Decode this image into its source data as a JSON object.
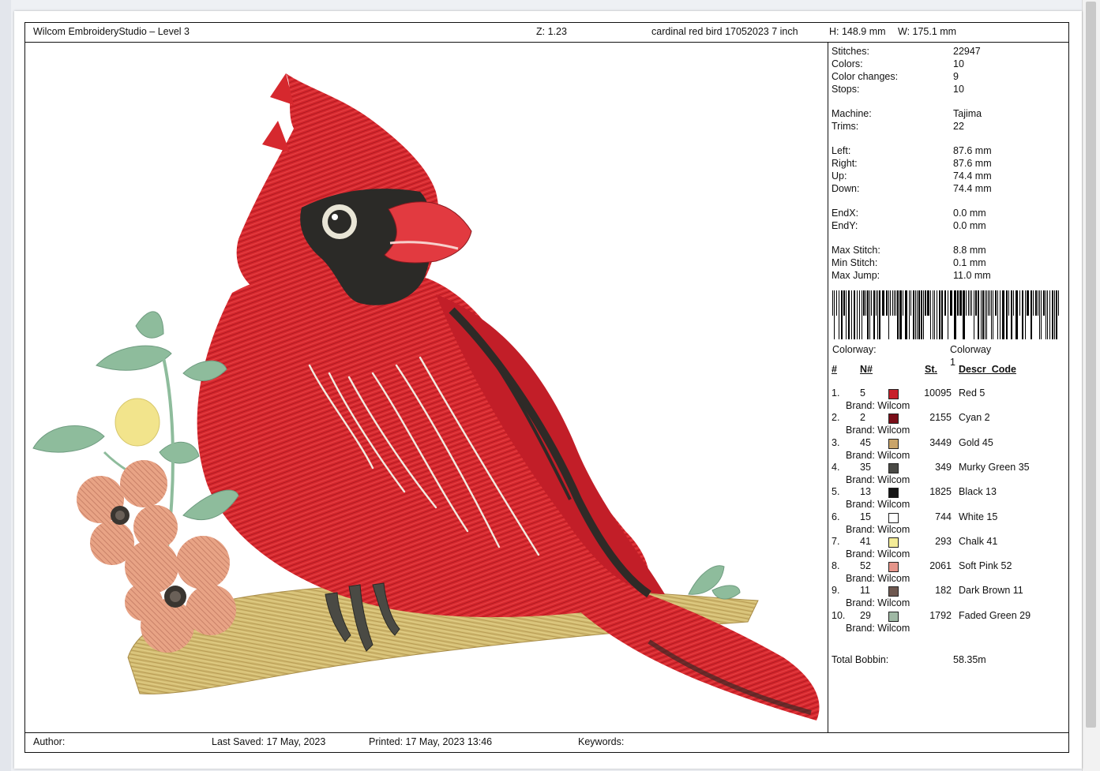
{
  "header": {
    "app": "Wilcom EmbroideryStudio – Level 3",
    "zoom": "Z: 1.23",
    "design_name": "cardinal red bird 17052023 7 inch",
    "height": "H: 148.9 mm",
    "width": "W: 175.1 mm"
  },
  "stats": [
    {
      "label": "Stitches:",
      "value": "22947"
    },
    {
      "label": "Colors:",
      "value": "10"
    },
    {
      "label": "Color changes:",
      "value": "9"
    },
    {
      "label": "Stops:",
      "value": "10"
    },
    {
      "label": "Machine:",
      "value": "Tajima"
    },
    {
      "label": "Trims:",
      "value": "22"
    },
    {
      "label": "Left:",
      "value": "87.6 mm"
    },
    {
      "label": "Right:",
      "value": "87.6 mm"
    },
    {
      "label": "Up:",
      "value": "74.4 mm"
    },
    {
      "label": "Down:",
      "value": "74.4 mm"
    },
    {
      "label": "EndX:",
      "value": "0.0 mm"
    },
    {
      "label": "EndY:",
      "value": "0.0 mm"
    },
    {
      "label": "Max Stitch:",
      "value": "8.8 mm"
    },
    {
      "label": "Min Stitch:",
      "value": "0.1 mm"
    },
    {
      "label": "Max Jump:",
      "value": "11.0 mm"
    }
  ],
  "colorway": {
    "label": "Colorway:",
    "value": "Colorway 1"
  },
  "table_headers": {
    "idx": "#",
    "num": "N#",
    "stitches": "St.",
    "descr": "Descr_Code"
  },
  "threads": [
    {
      "idx": "1.",
      "num": "5",
      "color": "#c8202a",
      "stitches": "10095",
      "descr": "Red 5",
      "brand": "Brand: Wilcom"
    },
    {
      "idx": "2.",
      "num": "2",
      "color": "#7a0e18",
      "stitches": "2155",
      "descr": "Cyan 2",
      "brand": "Brand: Wilcom"
    },
    {
      "idx": "3.",
      "num": "45",
      "color": "#c9a46a",
      "stitches": "3449",
      "descr": "Gold 45",
      "brand": "Brand: Wilcom"
    },
    {
      "idx": "4.",
      "num": "35",
      "color": "#4a4a46",
      "stitches": "349",
      "descr": "Murky Green 35",
      "brand": "Brand: Wilcom"
    },
    {
      "idx": "5.",
      "num": "13",
      "color": "#161616",
      "stitches": "1825",
      "descr": "Black 13",
      "brand": "Brand: Wilcom"
    },
    {
      "idx": "6.",
      "num": "15",
      "color": "#ffffff",
      "stitches": "744",
      "descr": "White 15",
      "brand": "Brand: Wilcom"
    },
    {
      "idx": "7.",
      "num": "41",
      "color": "#f4ec98",
      "stitches": "293",
      "descr": "Chalk 41",
      "brand": "Brand: Wilcom"
    },
    {
      "idx": "8.",
      "num": "52",
      "color": "#e5958a",
      "stitches": "2061",
      "descr": "Soft Pink 52",
      "brand": "Brand: Wilcom"
    },
    {
      "idx": "9.",
      "num": "11",
      "color": "#6e5850",
      "stitches": "182",
      "descr": "Dark Brown 11",
      "brand": "Brand: Wilcom"
    },
    {
      "idx": "10.",
      "num": "29",
      "color": "#9fb8a4",
      "stitches": "1792",
      "descr": "Faded Green 29",
      "brand": "Brand: Wilcom"
    }
  ],
  "total_bobbin": {
    "label": "Total Bobbin:",
    "value": "58.35m"
  },
  "footer": {
    "author": "Author:",
    "last_saved": "Last Saved: 17 May, 2023",
    "printed": "Printed: 17 May, 2023 13:46",
    "keywords": "Keywords:"
  }
}
